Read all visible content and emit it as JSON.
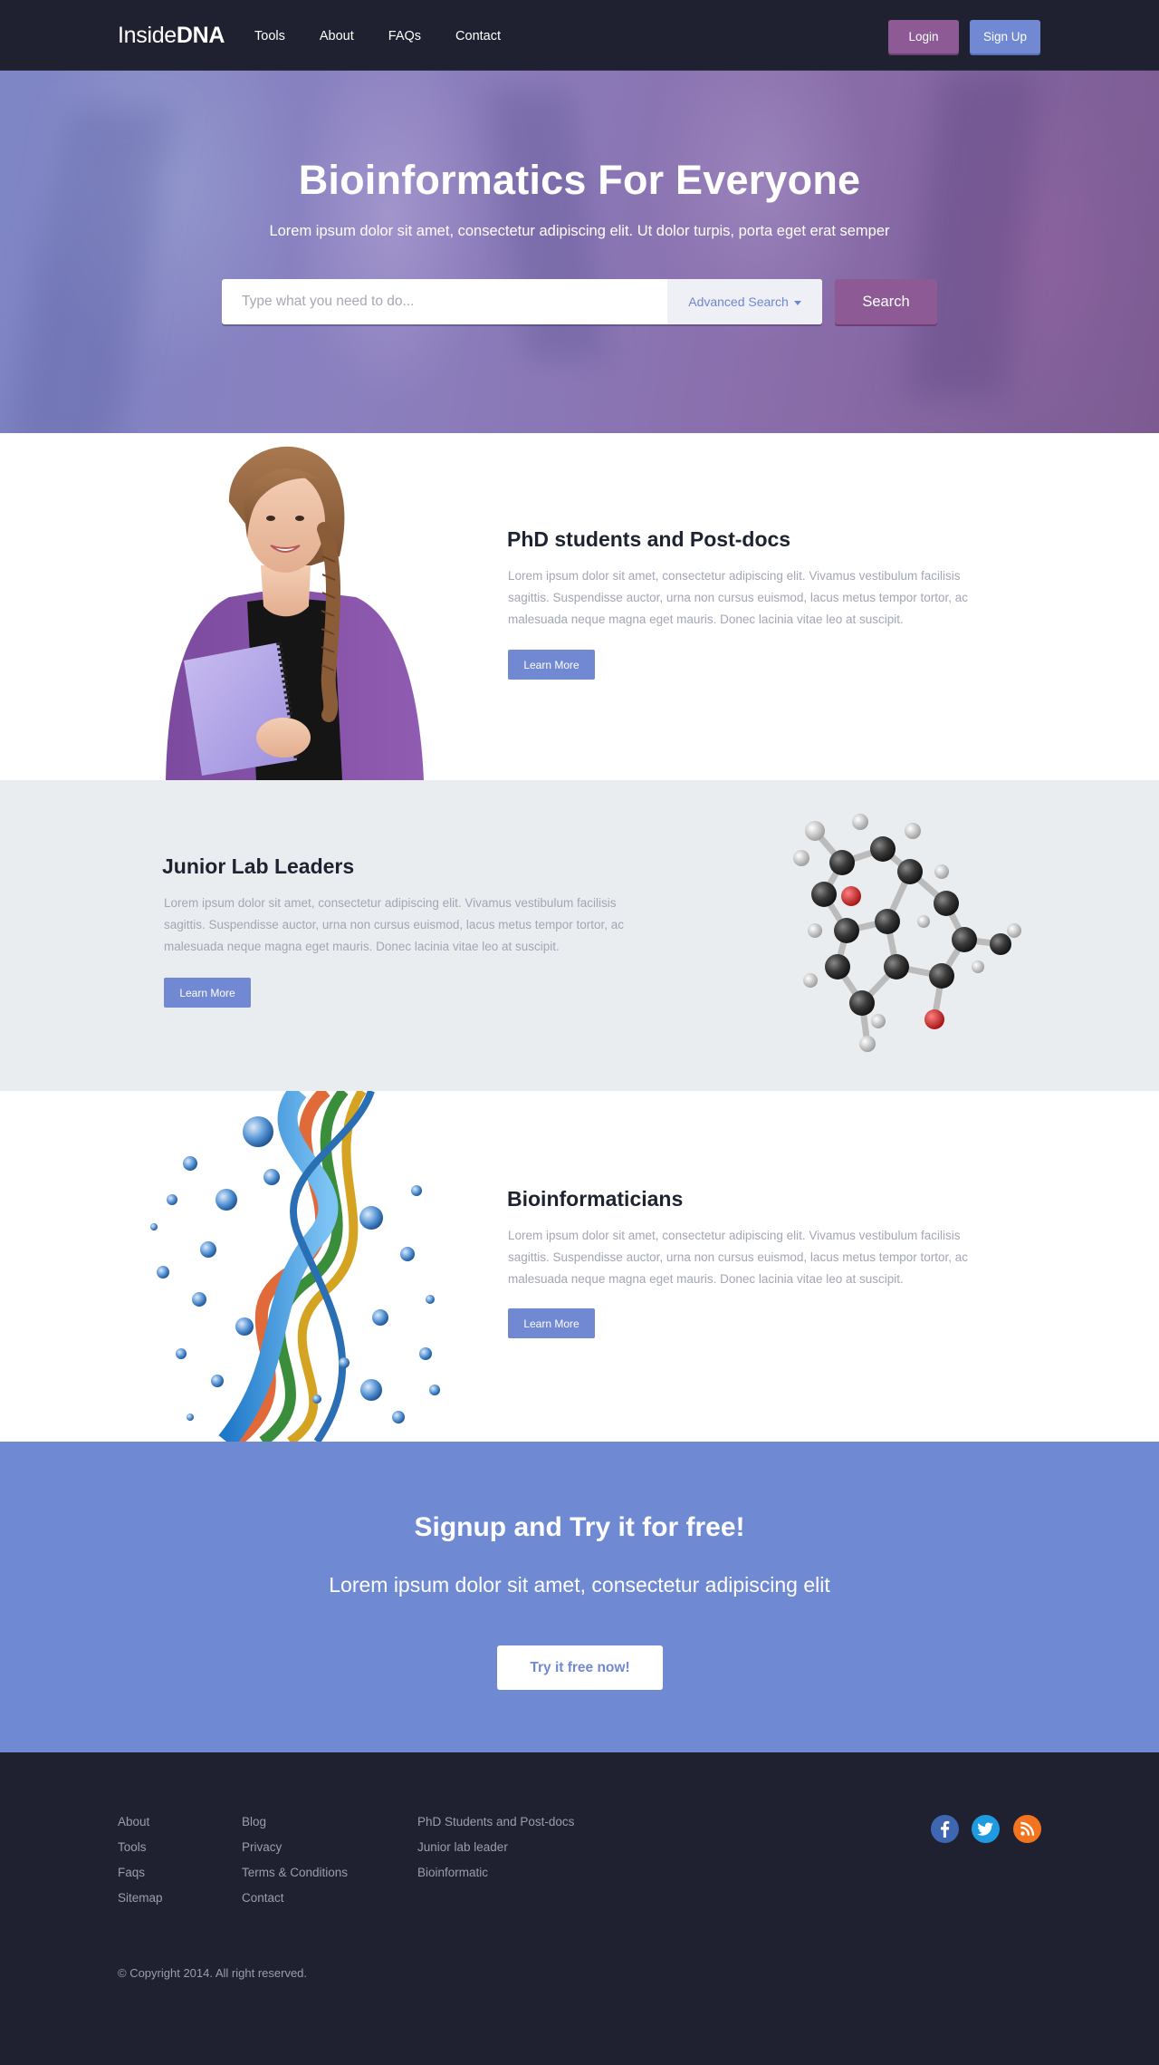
{
  "nav": {
    "brand_light": "Inside",
    "brand_bold": "DNA",
    "links": [
      "Tools",
      "About",
      "FAQs",
      "Contact"
    ],
    "login_label": "Login",
    "signup_label": "Sign Up"
  },
  "hero": {
    "title": "Bioinformatics For Everyone",
    "subtitle": "Lorem ipsum dolor sit amet, consectetur adipiscing elit. Ut dolor turpis, porta eget erat semper",
    "search_placeholder": "Type what you need to do...",
    "advanced_search_label": "Advanced Search",
    "search_button_label": "Search"
  },
  "features": [
    {
      "title": "PhD students and Post-docs",
      "text": "Lorem ipsum dolor sit amet, consectetur adipiscing elit. Vivamus vestibulum facilisis sagittis. Suspendisse auctor, urna non cursus euismod, lacus metus tempor tortor, ac malesuada neque magna eget mauris. Donec lacinia vitae leo at suscipit.",
      "button_label": "Learn More"
    },
    {
      "title": "Junior Lab Leaders",
      "text": "Lorem ipsum dolor sit amet, consectetur adipiscing elit. Vivamus vestibulum facilisis sagittis. Suspendisse auctor, urna non cursus euismod, lacus metus tempor tortor, ac malesuada neque magna eget mauris. Donec lacinia vitae leo at suscipit.",
      "button_label": "Learn More"
    },
    {
      "title": "Bioinformaticians",
      "text": "Lorem ipsum dolor sit amet, consectetur adipiscing elit. Vivamus vestibulum facilisis sagittis. Suspendisse auctor, urna non cursus euismod, lacus metus tempor tortor, ac malesuada neque magna eget mauris. Donec lacinia vitae leo at suscipit.",
      "button_label": "Learn More"
    }
  ],
  "signup": {
    "title": "Signup and Try it for free!",
    "subtitle": "Lorem ipsum dolor sit amet, consectetur adipiscing elit",
    "button_label": "Try it free now!"
  },
  "footer": {
    "col1": [
      "About",
      "Tools",
      "Faqs",
      "Sitemap"
    ],
    "col2": [
      "Blog",
      "Privacy",
      "Terms & Conditions",
      "Contact"
    ],
    "col3": [
      "PhD Students and Post-docs",
      "Junior lab leader",
      "Bioinformatic"
    ],
    "social_icons": [
      "facebook-icon",
      "twitter-icon",
      "rss-icon"
    ],
    "copyright": "© Copyright 2014. All right reserved."
  },
  "colors": {
    "nav_bg": "#1f2130",
    "purple": "#8d5a96",
    "blue": "#7189d3",
    "feature_alt_bg": "#eaedf0",
    "footer_bg": "#1f2130"
  }
}
